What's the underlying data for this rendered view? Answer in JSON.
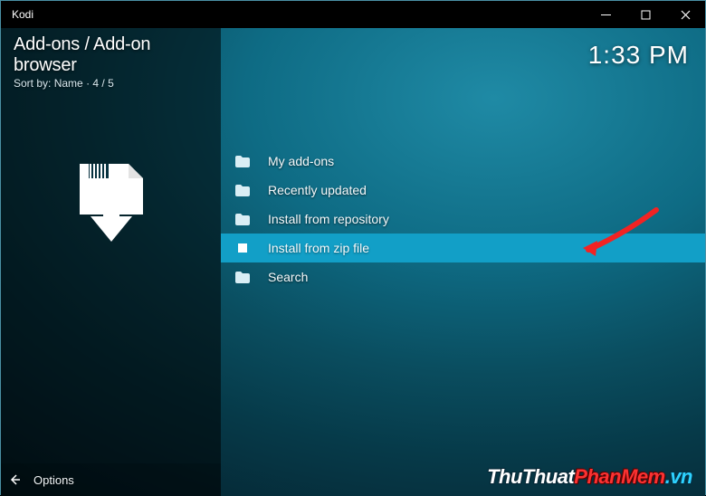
{
  "titlebar": {
    "app_name": "Kodi"
  },
  "header": {
    "breadcrumb": "Add-ons / Add-on browser",
    "sort_label": "Sort by:",
    "sort_value": "Name",
    "position": "4 / 5",
    "clock": "1:33 PM"
  },
  "menu": {
    "items": [
      {
        "label": "My add-ons",
        "icon": "folder",
        "selected": false
      },
      {
        "label": "Recently updated",
        "icon": "folder",
        "selected": false
      },
      {
        "label": "Install from repository",
        "icon": "folder",
        "selected": false
      },
      {
        "label": "Install from zip file",
        "icon": "file",
        "selected": true
      },
      {
        "label": "Search",
        "icon": "folder",
        "selected": false
      }
    ]
  },
  "footer": {
    "options_label": "Options"
  },
  "watermark": {
    "part1": "ThuThuat",
    "part2": "PhanMem",
    "part3": ".vn"
  },
  "annotation": {
    "type": "arrow",
    "color": "#f22323",
    "points_to": "Install from zip file"
  }
}
